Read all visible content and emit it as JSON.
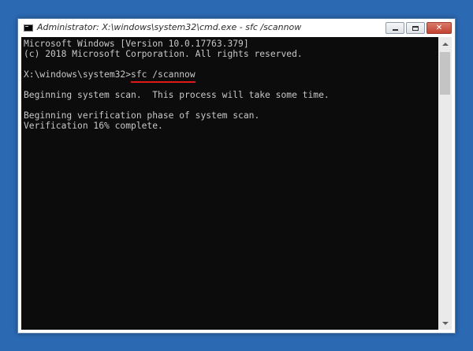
{
  "colors": {
    "desktop_background": "#2b69b3",
    "console_background": "#0c0c0c",
    "console_text": "#c8c8c8",
    "underline": "#e11818"
  },
  "window": {
    "title": "Administrator: X:\\windows\\system32\\cmd.exe - sfc  /scannow",
    "icon": "cmd-icon",
    "buttons": {
      "minimize": "minimize-icon",
      "maximize": "maximize-icon",
      "close_glyph": "✕"
    }
  },
  "console": {
    "lines": [
      "Microsoft Windows [Version 10.0.17763.379]",
      "(c) 2018 Microsoft Corporation. All rights reserved.",
      "",
      "",
      "Beginning system scan.  This process will take some time.",
      "",
      "Beginning verification phase of system scan.",
      "Verification 16% complete."
    ],
    "prompt": "X:\\windows\\system32>",
    "command": "sfc /scannow"
  }
}
